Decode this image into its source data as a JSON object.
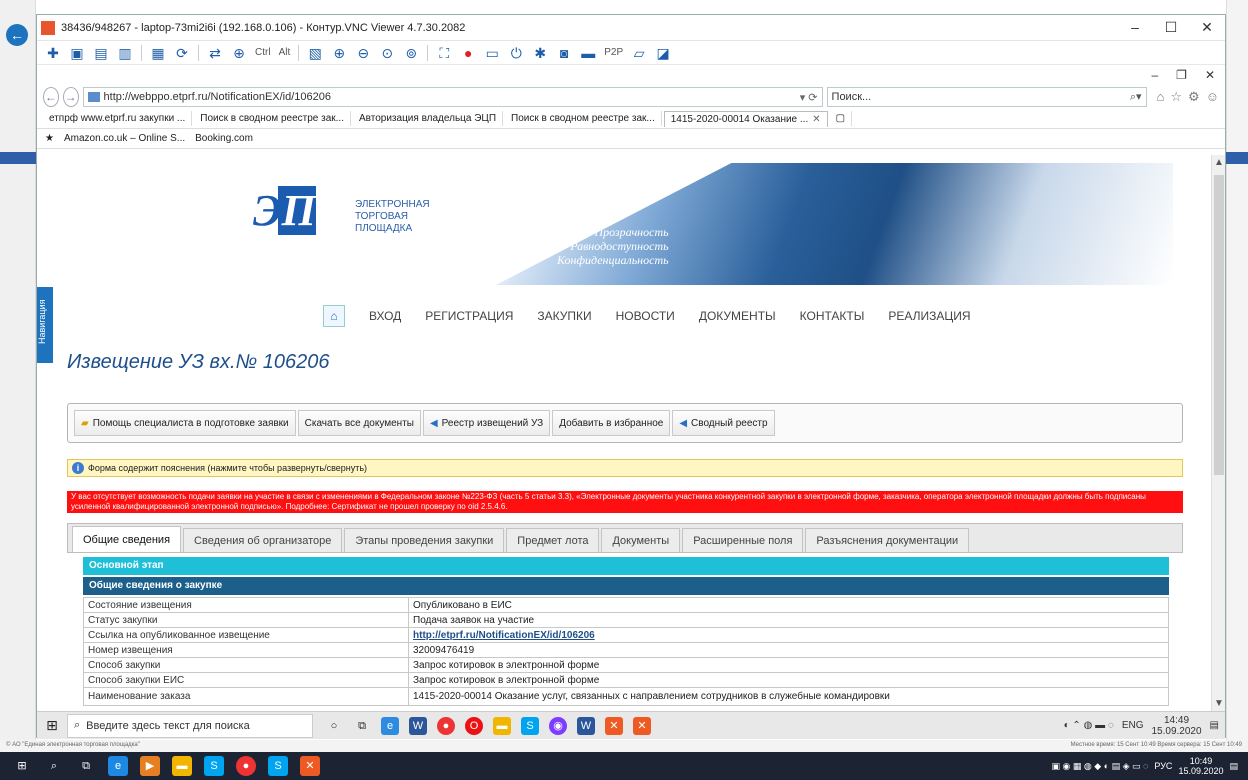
{
  "vnc": {
    "title": "38436/948267 - laptop-73mi2i6i (192.168.0.106) - Контур.VNC Viewer 4.7.30.2082",
    "toolbar_labels": [
      "Ctrl",
      "Alt",
      "P2P"
    ]
  },
  "browser": {
    "url": "http://webppo.etprf.ru/NotificationEX/id/106206",
    "search_placeholder": "Поиск...",
    "tabs": [
      "етпрф www.etprf.ru закупки ...",
      "Поиск в сводном реестре зак...",
      "Авторизация владельца ЭЦП",
      "Поиск в сводном реестре зак...",
      "1415-2020-00014 Оказание ..."
    ],
    "favorites": [
      "Amazon.co.uk – Online S...",
      "Booking.com"
    ]
  },
  "site": {
    "banner_text": [
      "ЭЛЕКТРОННАЯ",
      "ТОРГОВАЯ",
      "ПЛОЩАДКА"
    ],
    "slogans": [
      "Прозрачность",
      "Равнодоступность",
      "Конфиденциальность"
    ],
    "nav_side_label": "Навигация",
    "menu": [
      "ВХОД",
      "РЕГИСТРАЦИЯ",
      "ЗАКУПКИ",
      "НОВОСТИ",
      "ДОКУМЕНТЫ",
      "КОНТАКТЫ",
      "РЕАЛИЗАЦИЯ"
    ]
  },
  "notice": {
    "title": "Извещение УЗ вх.№ 106206",
    "toolbar": [
      "Помощь специалиста в подготовке заявки",
      "Скачать все документы",
      "Реестр извещений УЗ",
      "Добавить в избранное",
      "Сводный реестр"
    ],
    "info": "Форма содержит пояснения (нажмите чтобы развернуть/свернуть)",
    "warning": "У вас отсутствует возможность подачи заявки на участие в связи с изменениями в Федеральном законе №223-ФЗ (часть 5 статьи 3.3), «Электронные документы участника конкурентной закупки в электронной форме, заказчика, оператора электронной площадки должны быть подписаны усиленной квалифицированной электронной подписью». Подробнее: Сертификат не прошел проверку по oid 2.5.4.6.",
    "tabs": [
      "Общие сведения",
      "Сведения об организаторе",
      "Этапы проведения закупки",
      "Предмет лота",
      "Документы",
      "Расширенные поля",
      "Разъяснения документации"
    ],
    "stage": "Основной этап",
    "section": "Общие сведения о закупке",
    "rows": [
      {
        "k": "Состояние извещения",
        "v": "Опубликовано в ЕИС"
      },
      {
        "k": "Статус закупки",
        "v": "Подача заявок на участие"
      },
      {
        "k": "Ссылка на опубликованное извещение",
        "v": "http://etprf.ru/NotificationEX/id/106206"
      },
      {
        "k": "Номер извещения",
        "v": "32009476419"
      },
      {
        "k": "Способ закупки",
        "v": "Запрос котировок в электронной форме"
      },
      {
        "k": "Способ закупки ЕИС",
        "v": "Запрос котировок в электронной форме"
      },
      {
        "k": "Наименование заказа",
        "v": "1415-2020-00014 Оказание услуг, связанных с направлением сотрудников в служебные командировки"
      }
    ]
  },
  "remote_taskbar": {
    "search_placeholder": "Введите здесь текст для поиска",
    "lang": "ENG",
    "time": "14:49",
    "date": "15.09.2020"
  },
  "host": {
    "status_left": "© АО \"Единая электронная торговая площадка\"",
    "status_right": "Местное время: 15 Сент 10:49 Время сервера: 15 Сент 10:49",
    "lang": "РУС",
    "time": "10:49",
    "date": "15.09.2020"
  },
  "colors": {
    "accent": "#1e73be",
    "stage_bar": "#1fbfd8",
    "section_bar": "#1b5f8a",
    "warning_bg": "#ff0f0f"
  }
}
